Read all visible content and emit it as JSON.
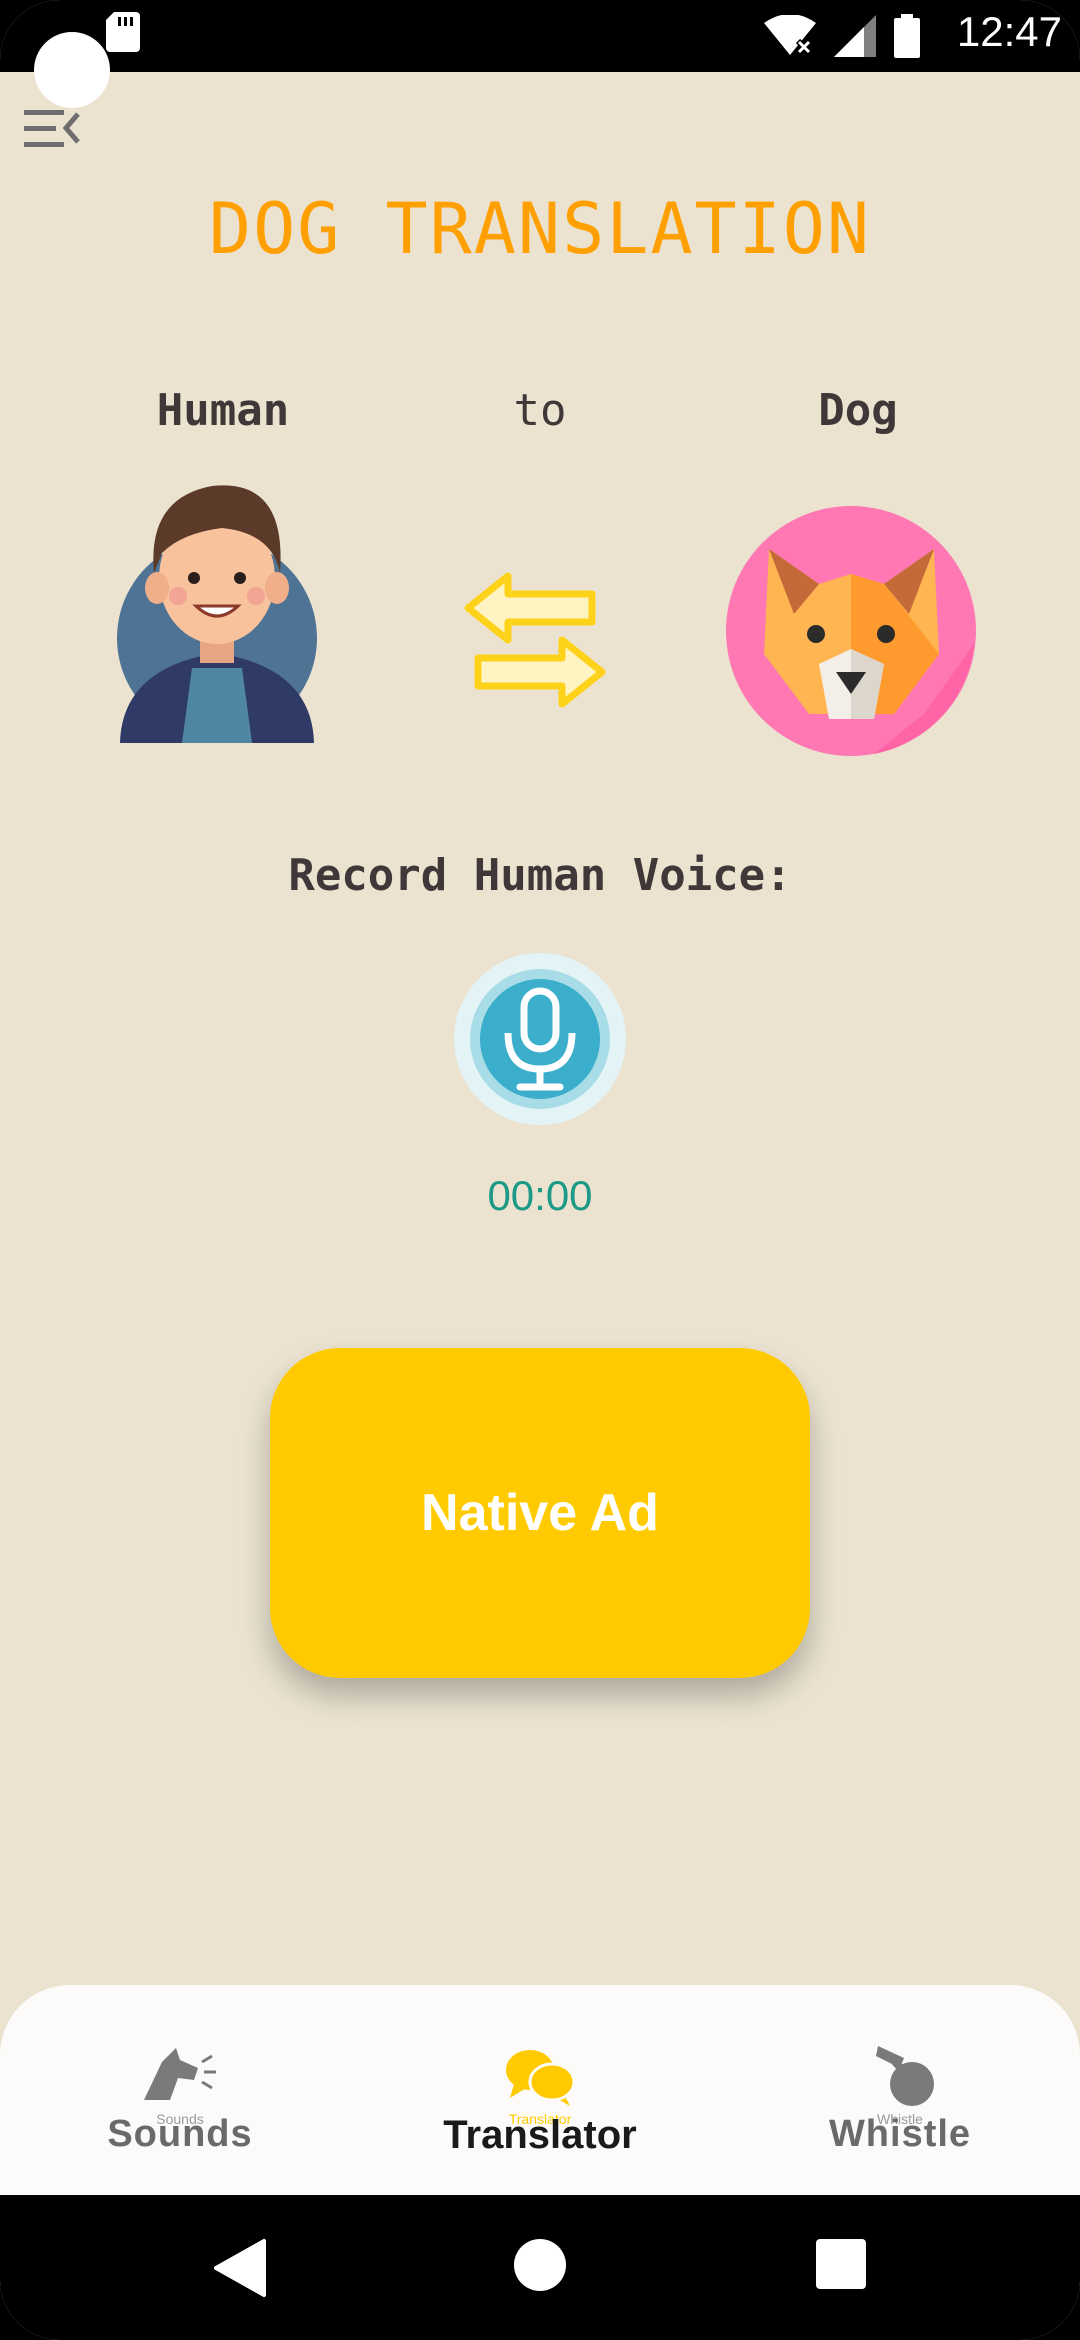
{
  "status_bar": {
    "time": "12:47"
  },
  "header": {
    "menu_icon": "menu-collapse-icon",
    "title": "DOG TRANSLATION"
  },
  "translation": {
    "from_label": "Human",
    "connector_label": "to",
    "to_label": "Dog",
    "swap_icon": "swap-arrows-icon"
  },
  "recorder": {
    "prompt": "Record Human Voice:",
    "mic_icon": "microphone-icon",
    "timer": "00:00"
  },
  "ad": {
    "label": "Native Ad"
  },
  "bottom_nav": {
    "items": [
      {
        "label": "Sounds",
        "tiny_label": "Sounds",
        "icon": "barking-dog-icon",
        "active": false
      },
      {
        "label": "Translator",
        "tiny_label": "Translator",
        "icon": "chat-bubbles-icon",
        "active": true
      },
      {
        "label": "Whistle",
        "tiny_label": "Whistle",
        "icon": "whistle-icon",
        "active": false
      }
    ]
  },
  "colors": {
    "background": "#ebe3d0",
    "title": "#ff9f00",
    "accent_yellow": "#ffcb00",
    "timer": "#1c9a86",
    "mic": "#3aaecb"
  }
}
